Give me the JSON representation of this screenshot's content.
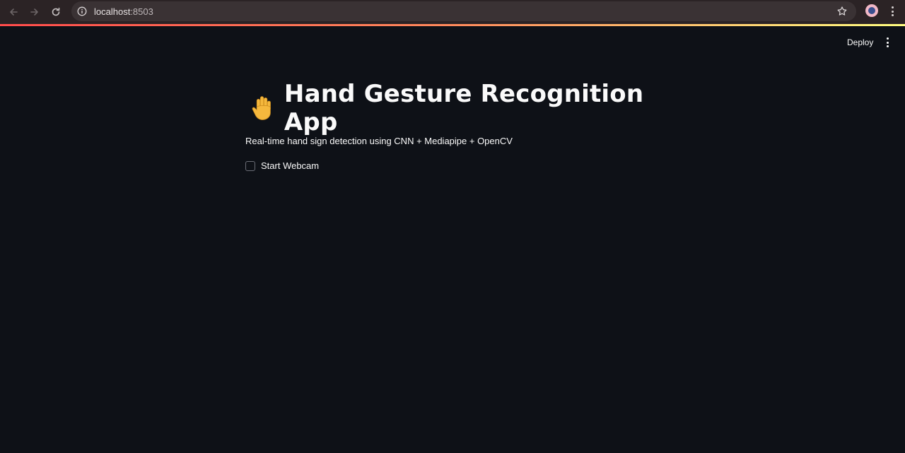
{
  "browser": {
    "url_host": "localhost",
    "url_port": ":8503",
    "back_icon": "arrow-left-icon",
    "forward_icon": "arrow-right-icon",
    "reload_icon": "reload-icon",
    "info_icon": "info-icon",
    "star_icon": "star-icon",
    "profile_icon": "profile-avatar-icon",
    "menu_icon": "kebab-menu-icon"
  },
  "header": {
    "deploy_label": "Deploy",
    "menu_icon": "kebab-menu-icon",
    "accent_gradient": [
      "#ff4b4b",
      "#fffd80"
    ]
  },
  "main": {
    "title_icon": "raised-hand-icon",
    "title": "Hand Gesture Recognition App",
    "subtitle": "Real-time hand sign detection using CNN + Mediapipe + OpenCV",
    "webcam_checkbox": {
      "label": "Start Webcam",
      "checked": false
    }
  },
  "colors": {
    "background": "#0e1117",
    "text": "#fafafa",
    "browser_bar": "#2b2325"
  }
}
